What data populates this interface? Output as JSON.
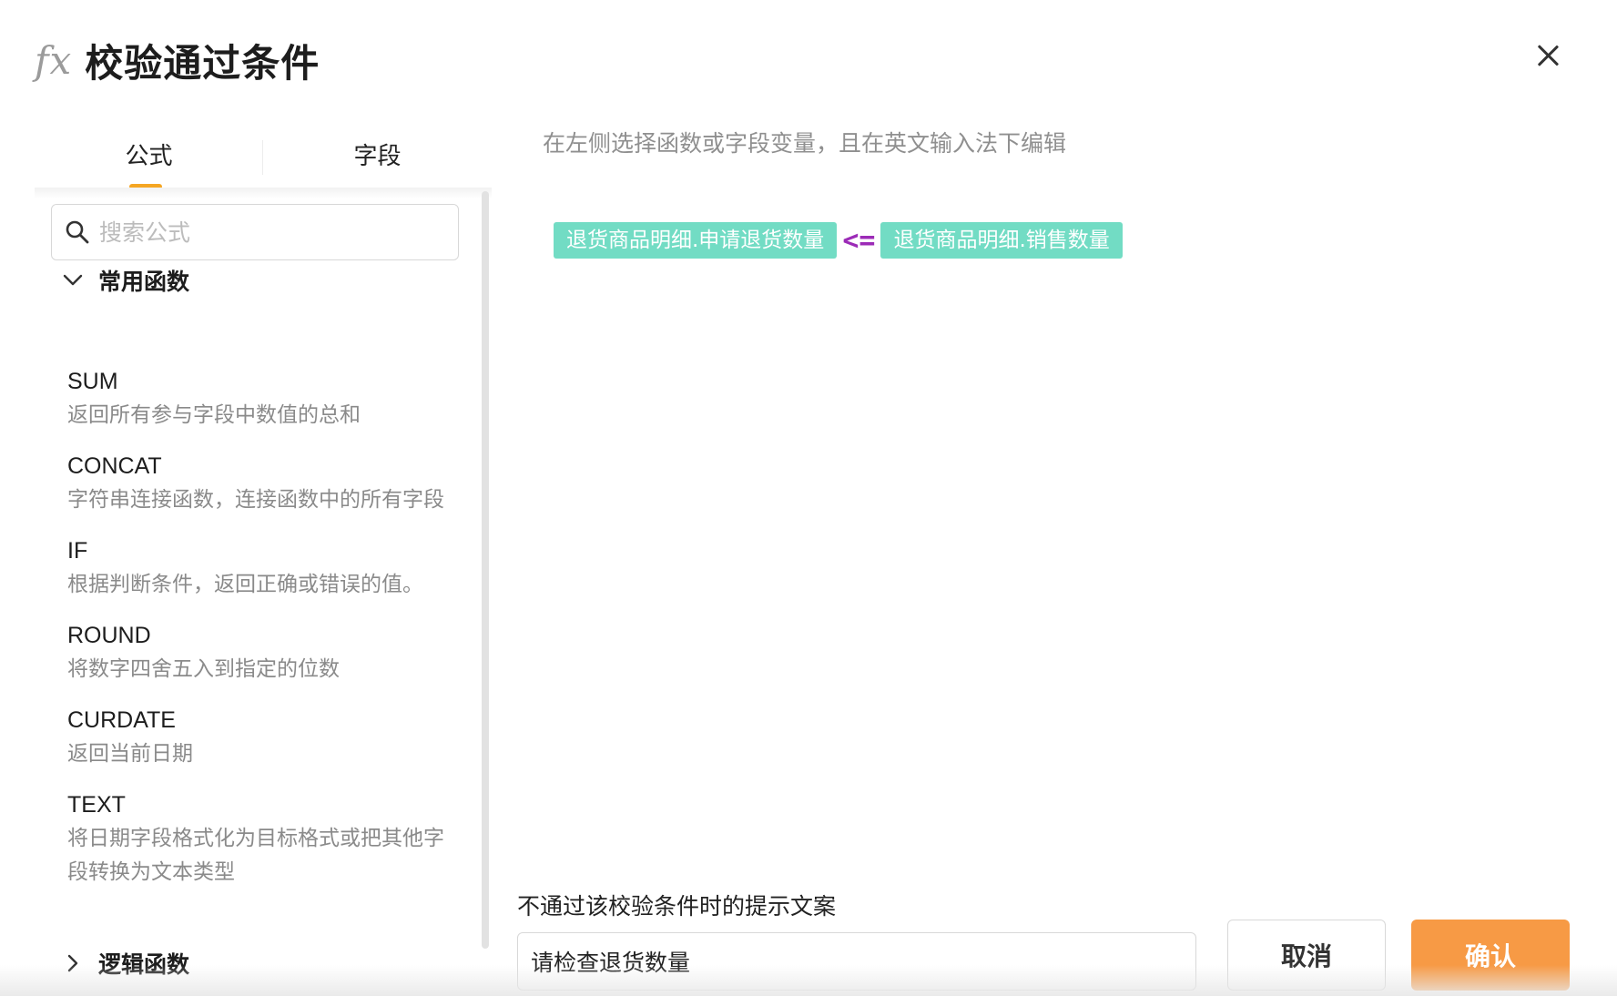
{
  "dialog": {
    "icon": "fx",
    "title": "校验通过条件",
    "close_icon": "close-icon"
  },
  "tabs": [
    {
      "label": "公式",
      "active": true
    },
    {
      "label": "字段",
      "active": false
    }
  ],
  "search": {
    "placeholder": "搜索公式",
    "value": ""
  },
  "groups": [
    {
      "label": "常用函数",
      "expanded": true
    },
    {
      "label": "逻辑函数",
      "expanded": false
    }
  ],
  "functions": [
    {
      "name": "SUM",
      "desc": "返回所有参与字段中数值的总和"
    },
    {
      "name": "CONCAT",
      "desc": "字符串连接函数，连接函数中的所有字段"
    },
    {
      "name": "IF",
      "desc": "根据判断条件，返回正确或错误的值。"
    },
    {
      "name": "ROUND",
      "desc": "将数字四舍五入到指定的位数"
    },
    {
      "name": "CURDATE",
      "desc": "返回当前日期"
    },
    {
      "name": "TEXT",
      "desc": "将日期字段格式化为目标格式或把其他字段转换为文本类型"
    }
  ],
  "editor": {
    "hint": "在左侧选择函数或字段变量，且在英文输入法下编辑",
    "formula": {
      "left_field": "退货商品明细.申请退货数量",
      "operator": "<=",
      "right_field": "退货商品明细.销售数量"
    }
  },
  "tip": {
    "label": "不通过该校验条件时的提示文案",
    "value": "请检查退货数量"
  },
  "buttons": {
    "cancel": "取消",
    "confirm": "确认"
  },
  "colors": {
    "accent": "#f5a623",
    "confirm": "#f79a45",
    "field_tag": "#72dcc4",
    "operator": "#9c2bb7"
  }
}
